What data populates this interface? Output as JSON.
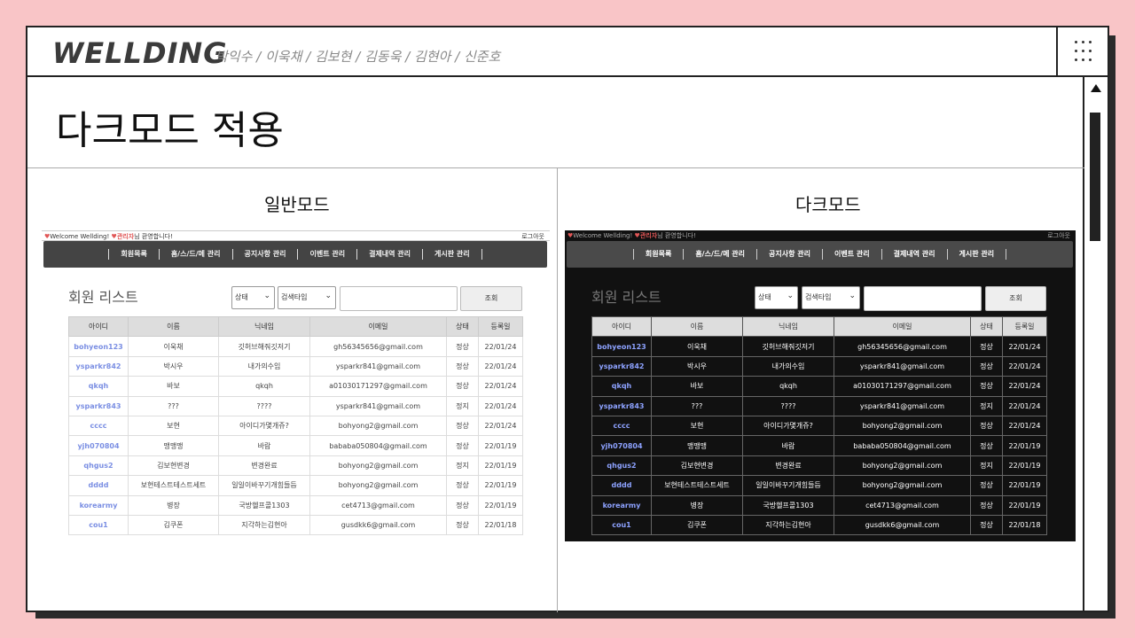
{
  "header": {
    "brand": "WELLDING",
    "team": "박익수 / 이욱채 / 김보현 / 김동욱 / 김현아 / 신준호",
    "menu_icon": "grid-dots-icon"
  },
  "slide": {
    "title": "다크모드 적용",
    "light_label": "일반모드",
    "dark_label": "다크모드"
  },
  "app": {
    "heart": "♥",
    "welcome": "Welcome Wellding!",
    "admin_name": "관리자",
    "greeting_suffix": "님 환영합니다!",
    "logout": "로그아웃",
    "nav": [
      "회원목록",
      "홈/스/드/메 관리",
      "공지사항 관리",
      "이벤트 관리",
      "결제내역 관리",
      "게시판 관리"
    ],
    "list_title": "회원 리스트",
    "status_select": "상태",
    "type_select": "검색타입",
    "search_value": "",
    "search_button": "조회",
    "columns": [
      "아이디",
      "이름",
      "닉네임",
      "이메일",
      "상태",
      "등록일"
    ],
    "rows": [
      [
        "bohyeon123",
        "이욱채",
        "깃허브해줘깃저기",
        "gh56345656@gmail.com",
        "정상",
        "22/01/24"
      ],
      [
        "ysparkr842",
        "박시우",
        "내가의수임",
        "ysparkr841@gmail.com",
        "정상",
        "22/01/24"
      ],
      [
        "qkqh",
        "바보",
        "qkqh",
        "a01030171297@gmail.com",
        "정상",
        "22/01/24"
      ],
      [
        "ysparkr843",
        "???",
        "????",
        "ysparkr841@gmail.com",
        "정지",
        "22/01/24"
      ],
      [
        "cccc",
        "보현",
        "아이디가몇개쥬?",
        "bohyong2@gmail.com",
        "정상",
        "22/01/24"
      ],
      [
        "yjh070804",
        "맹맹맹",
        "바람",
        "bababa050804@gmail.com",
        "정상",
        "22/01/19"
      ],
      [
        "qhgus2",
        "김보현변경",
        "변경완료",
        "bohyong2@gmail.com",
        "정지",
        "22/01/19"
      ],
      [
        "dddd",
        "보현테스트테스트세트",
        "일일이바꾸기개힘들듬",
        "bohyong2@gmail.com",
        "정상",
        "22/01/19"
      ],
      [
        "korearmy",
        "병장",
        "국방헬프콜1303",
        "cet4713@gmail.com",
        "정상",
        "22/01/19"
      ],
      [
        "cou1",
        "김쿠폰",
        "지각하는김현아",
        "gusdkk6@gmail.com",
        "정상",
        "22/01/18"
      ]
    ]
  },
  "colors": {
    "background": "#f9c5c7",
    "dark_bg": "#111111",
    "nav_bg": "#444444",
    "id_link": "#7b8fe3",
    "accent": "#e05656"
  }
}
